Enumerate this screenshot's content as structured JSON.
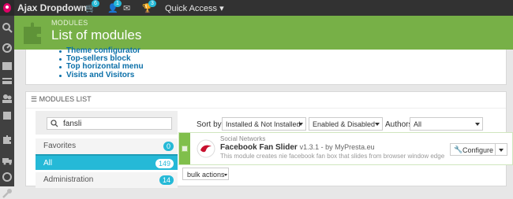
{
  "topbar": {
    "shop_name": "Ajax Dropdown",
    "orders_badge": "6",
    "customers_badge": "1",
    "messages_badge": "",
    "trophy_badge": "3",
    "quick_access": "Quick Access"
  },
  "header": {
    "breadcrumb": "MODULES",
    "title": "List of modules"
  },
  "link_list": [
    "Theme configurator",
    "Top-sellers block",
    "Top horizontal menu",
    "Visits and Visitors"
  ],
  "modules_panel": {
    "heading": "MODULES LIST",
    "search_value": "fansli",
    "categories": [
      {
        "label": "Favorites",
        "count": "0"
      },
      {
        "label": "All",
        "count": "149"
      },
      {
        "label": "Administration",
        "count": "14"
      }
    ],
    "sort_by_label": "Sort by",
    "filter_install": "Installed & Not Installed",
    "filter_status": "Enabled & Disabled",
    "authors_label": "Authors",
    "filter_authors": "All"
  },
  "module": {
    "tab": "Social Networks",
    "name": "Facebook Fan Slider",
    "version": "v1.3.1 - by MyPresta.eu",
    "description": "This module creates nie facebook fan box that slides from browser window edge",
    "configure_label": "Configure"
  },
  "bulk_actions_label": "bulk actions",
  "colors": {
    "accent": "#25b9d7",
    "header_green": "#77b047",
    "topbar": "#323232",
    "module_stripe": "#80bf4b"
  }
}
